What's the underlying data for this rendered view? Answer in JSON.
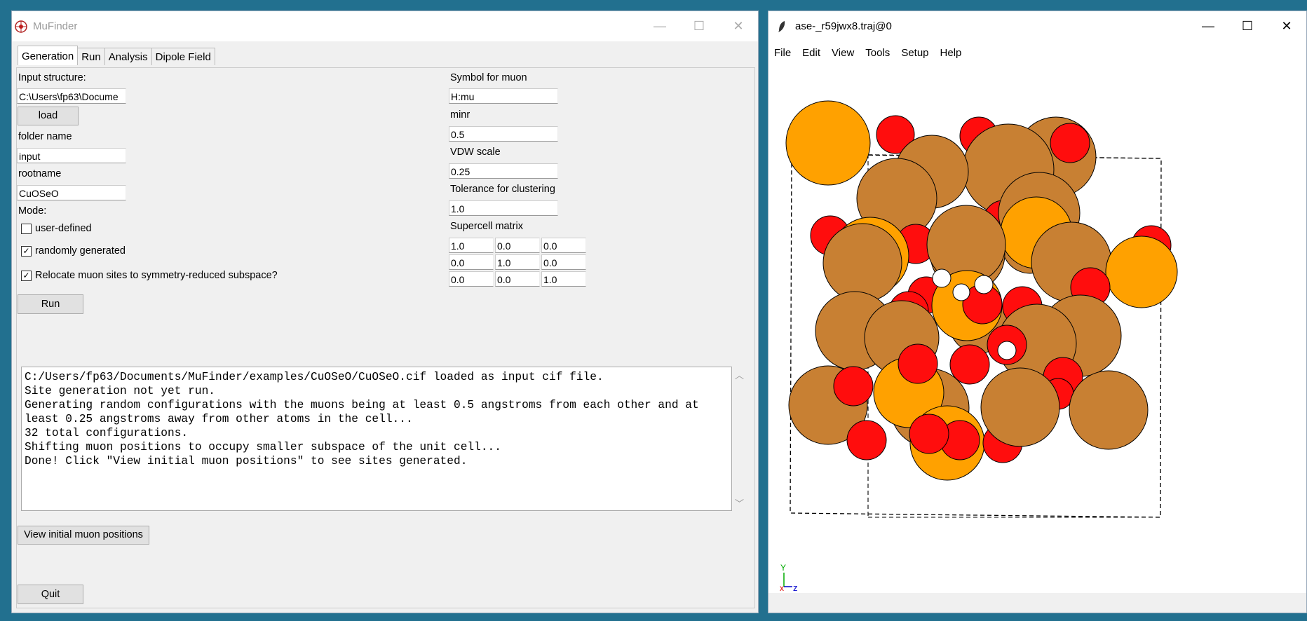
{
  "left_window": {
    "title": "MuFinder",
    "controls": {
      "minimize": "—",
      "maximize": "☐",
      "close": "✕"
    },
    "tabs": [
      "Generation",
      "Run",
      "Analysis",
      "Dipole Field"
    ],
    "input_structure_label": "Input structure:",
    "input_structure_value": "C:\\Users\\fp63\\Docume",
    "load_button": "load",
    "folder_name_label": "folder name",
    "folder_name_value": "input",
    "rootname_label": "rootname",
    "rootname_value": "CuOSeO",
    "mode_label": "Mode:",
    "user_defined_label": "user-defined",
    "user_defined_checked": false,
    "randomly_generated_label": "randomly generated",
    "randomly_generated_checked": true,
    "relocate_label": "Relocate muon sites to symmetry-reduced subspace?",
    "relocate_checked": true,
    "run_button": "Run",
    "symbol_label": "Symbol for muon",
    "symbol_value": "H:mu",
    "minr_label": "minr",
    "minr_value": "0.5",
    "vdw_label": "VDW scale",
    "vdw_value": "0.25",
    "tolerance_label": "Tolerance for clustering",
    "tolerance_value": "1.0",
    "supercell_label": "Supercell matrix",
    "supercell": [
      [
        "1.0",
        "0.0",
        "0.0"
      ],
      [
        "0.0",
        "1.0",
        "0.0"
      ],
      [
        "0.0",
        "0.0",
        "1.0"
      ]
    ],
    "console_lines": [
      "C:/Users/fp63/Documents/MuFinder/examples/CuOSeO/CuOSeO.cif loaded as input cif file.",
      "Site generation not yet run.",
      "Generating random configurations with the muons being at least 0.5 angstroms from each other and at",
      "least 0.25 angstroms away from other atoms in the cell...",
      "32 total configurations.",
      "Shifting muon positions to occupy smaller subspace of the unit cell...",
      "Done! Click \"View initial muon positions\" to see sites generated."
    ],
    "view_button": "View initial muon positions",
    "quit_button": "Quit"
  },
  "right_window": {
    "title": "ase-_r59jwx8.traj@0",
    "controls": {
      "minimize": "—",
      "maximize": "☐",
      "close": "✕"
    },
    "menus": [
      "File",
      "Edit",
      "View",
      "Tools",
      "Setup",
      "Help"
    ],
    "axes": {
      "y": "Y",
      "x": "x",
      "z": "z"
    }
  },
  "colors": {
    "desktop": "#22708f",
    "oxygen": "#ff0d0d",
    "copper": "#c88033",
    "selenium": "#ffa100",
    "muon": "#ffffff"
  }
}
